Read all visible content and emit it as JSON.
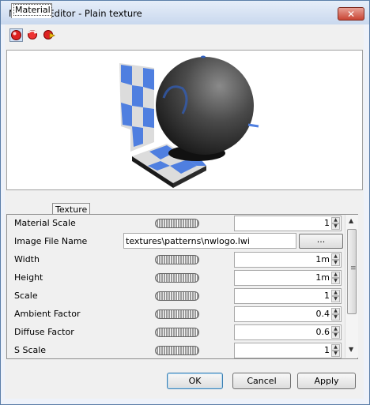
{
  "window": {
    "title": "Material Editor - Plain texture",
    "close_glyph": "✕"
  },
  "toolbar": {
    "buttons": [
      {
        "icon": "render-sphere-icon"
      },
      {
        "icon": "rotate-arrows-icon"
      },
      {
        "icon": "sphere-settings-icon"
      }
    ]
  },
  "tabs": [
    {
      "label": "Material",
      "active": true
    },
    {
      "label": "Texture",
      "active": false
    }
  ],
  "properties": [
    {
      "label": "Material Scale",
      "control": "spinner",
      "value": "1"
    },
    {
      "label": "Image File Name",
      "control": "file",
      "value": "textures\\patterns\\nwlogo.lwi",
      "button": "..."
    },
    {
      "label": "Width",
      "control": "spinner",
      "value": "1m"
    },
    {
      "label": "Height",
      "control": "spinner",
      "value": "1m"
    },
    {
      "label": "Scale",
      "control": "spinner",
      "value": "1"
    },
    {
      "label": "Ambient Factor",
      "control": "spinner",
      "value": "0.4"
    },
    {
      "label": "Diffuse Factor",
      "control": "spinner",
      "value": "0.6"
    },
    {
      "label": "S Scale",
      "control": "spinner",
      "value": "1"
    }
  ],
  "buttons": {
    "ok": "OK",
    "cancel": "Cancel",
    "apply": "Apply"
  },
  "colors": {
    "accent": "#3c7fb1",
    "checker_blue": "#4f7fe0",
    "close_red": "#c94534"
  }
}
